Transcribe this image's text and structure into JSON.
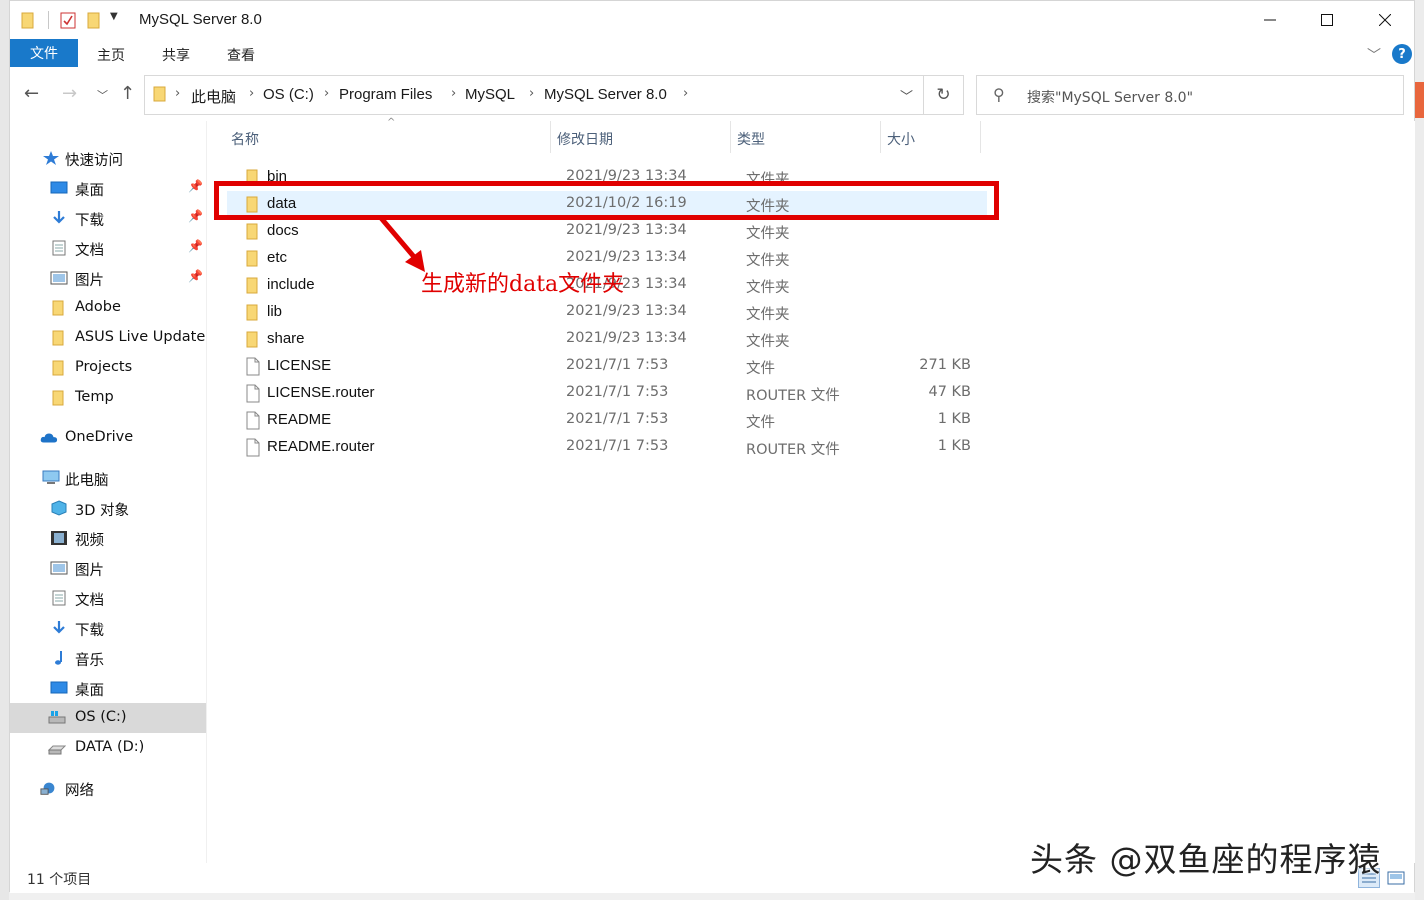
{
  "window": {
    "title": "MySQL Server 8.0"
  },
  "ribbon": {
    "tabs": [
      "文件",
      "主页",
      "共享",
      "查看"
    ],
    "help_label": "?"
  },
  "address": {
    "crumbs": [
      "此电脑",
      "OS (C:)",
      "Program Files",
      "MySQL",
      "MySQL Server 8.0"
    ],
    "search_placeholder": "搜索\"MySQL Server 8.0\""
  },
  "sidebar": {
    "quick_access": {
      "label": "快速访问",
      "icon": "star-icon"
    },
    "quick_items": [
      {
        "label": "桌面",
        "icon": "desktop-icon",
        "pinned": true
      },
      {
        "label": "下载",
        "icon": "download-icon",
        "pinned": true
      },
      {
        "label": "文档",
        "icon": "document-icon",
        "pinned": true
      },
      {
        "label": "图片",
        "icon": "picture-icon",
        "pinned": true
      },
      {
        "label": "Adobe",
        "icon": "folder-icon",
        "pinned": false
      },
      {
        "label": "ASUS Live Update",
        "icon": "folder-icon",
        "pinned": false
      },
      {
        "label": "Projects",
        "icon": "folder-icon",
        "pinned": false
      },
      {
        "label": "Temp",
        "icon": "folder-icon",
        "pinned": false
      }
    ],
    "onedrive": {
      "label": "OneDrive",
      "icon": "cloud-icon"
    },
    "this_pc": {
      "label": "此电脑",
      "icon": "computer-icon"
    },
    "pc_items": [
      {
        "label": "3D 对象",
        "icon": "cube-icon"
      },
      {
        "label": "视频",
        "icon": "video-icon"
      },
      {
        "label": "图片",
        "icon": "picture-icon"
      },
      {
        "label": "文档",
        "icon": "document-icon"
      },
      {
        "label": "下载",
        "icon": "download-icon"
      },
      {
        "label": "音乐",
        "icon": "music-icon"
      },
      {
        "label": "桌面",
        "icon": "desktop-icon"
      },
      {
        "label": "OS (C:)",
        "icon": "drive-icon",
        "selected": true
      },
      {
        "label": "DATA (D:)",
        "icon": "drive-icon"
      }
    ],
    "network": {
      "label": "网络",
      "icon": "network-icon"
    }
  },
  "columns": [
    "名称",
    "修改日期",
    "类型",
    "大小"
  ],
  "files": [
    {
      "name": "bin",
      "date": "2021/9/23 13:34",
      "type": "文件夹",
      "size": "",
      "kind": "folder"
    },
    {
      "name": "data",
      "date": "2021/10/2 16:19",
      "type": "文件夹",
      "size": "",
      "kind": "folder",
      "selected": true
    },
    {
      "name": "docs",
      "date": "2021/9/23 13:34",
      "type": "文件夹",
      "size": "",
      "kind": "folder"
    },
    {
      "name": "etc",
      "date": "2021/9/23 13:34",
      "type": "文件夹",
      "size": "",
      "kind": "folder"
    },
    {
      "name": "include",
      "date": "2021/9/23 13:34",
      "type": "文件夹",
      "size": "",
      "kind": "folder"
    },
    {
      "name": "lib",
      "date": "2021/9/23 13:34",
      "type": "文件夹",
      "size": "",
      "kind": "folder"
    },
    {
      "name": "share",
      "date": "2021/9/23 13:34",
      "type": "文件夹",
      "size": "",
      "kind": "folder"
    },
    {
      "name": "LICENSE",
      "date": "2021/7/1 7:53",
      "type": "文件",
      "size": "271 KB",
      "kind": "file"
    },
    {
      "name": "LICENSE.router",
      "date": "2021/7/1 7:53",
      "type": "ROUTER 文件",
      "size": "47 KB",
      "kind": "file"
    },
    {
      "name": "README",
      "date": "2021/7/1 7:53",
      "type": "文件",
      "size": "1 KB",
      "kind": "file"
    },
    {
      "name": "README.router",
      "date": "2021/7/1 7:53",
      "type": "ROUTER 文件",
      "size": "1 KB",
      "kind": "file"
    }
  ],
  "annotation": {
    "text": "生成新的data文件夹",
    "color": "#e00000"
  },
  "status": {
    "item_count": "11 个项目"
  },
  "watermark": "头条 @双鱼座的程序猿",
  "colors": {
    "accent": "#1979ca",
    "selection": "#e5f3ff",
    "folder": "#f8d775"
  }
}
